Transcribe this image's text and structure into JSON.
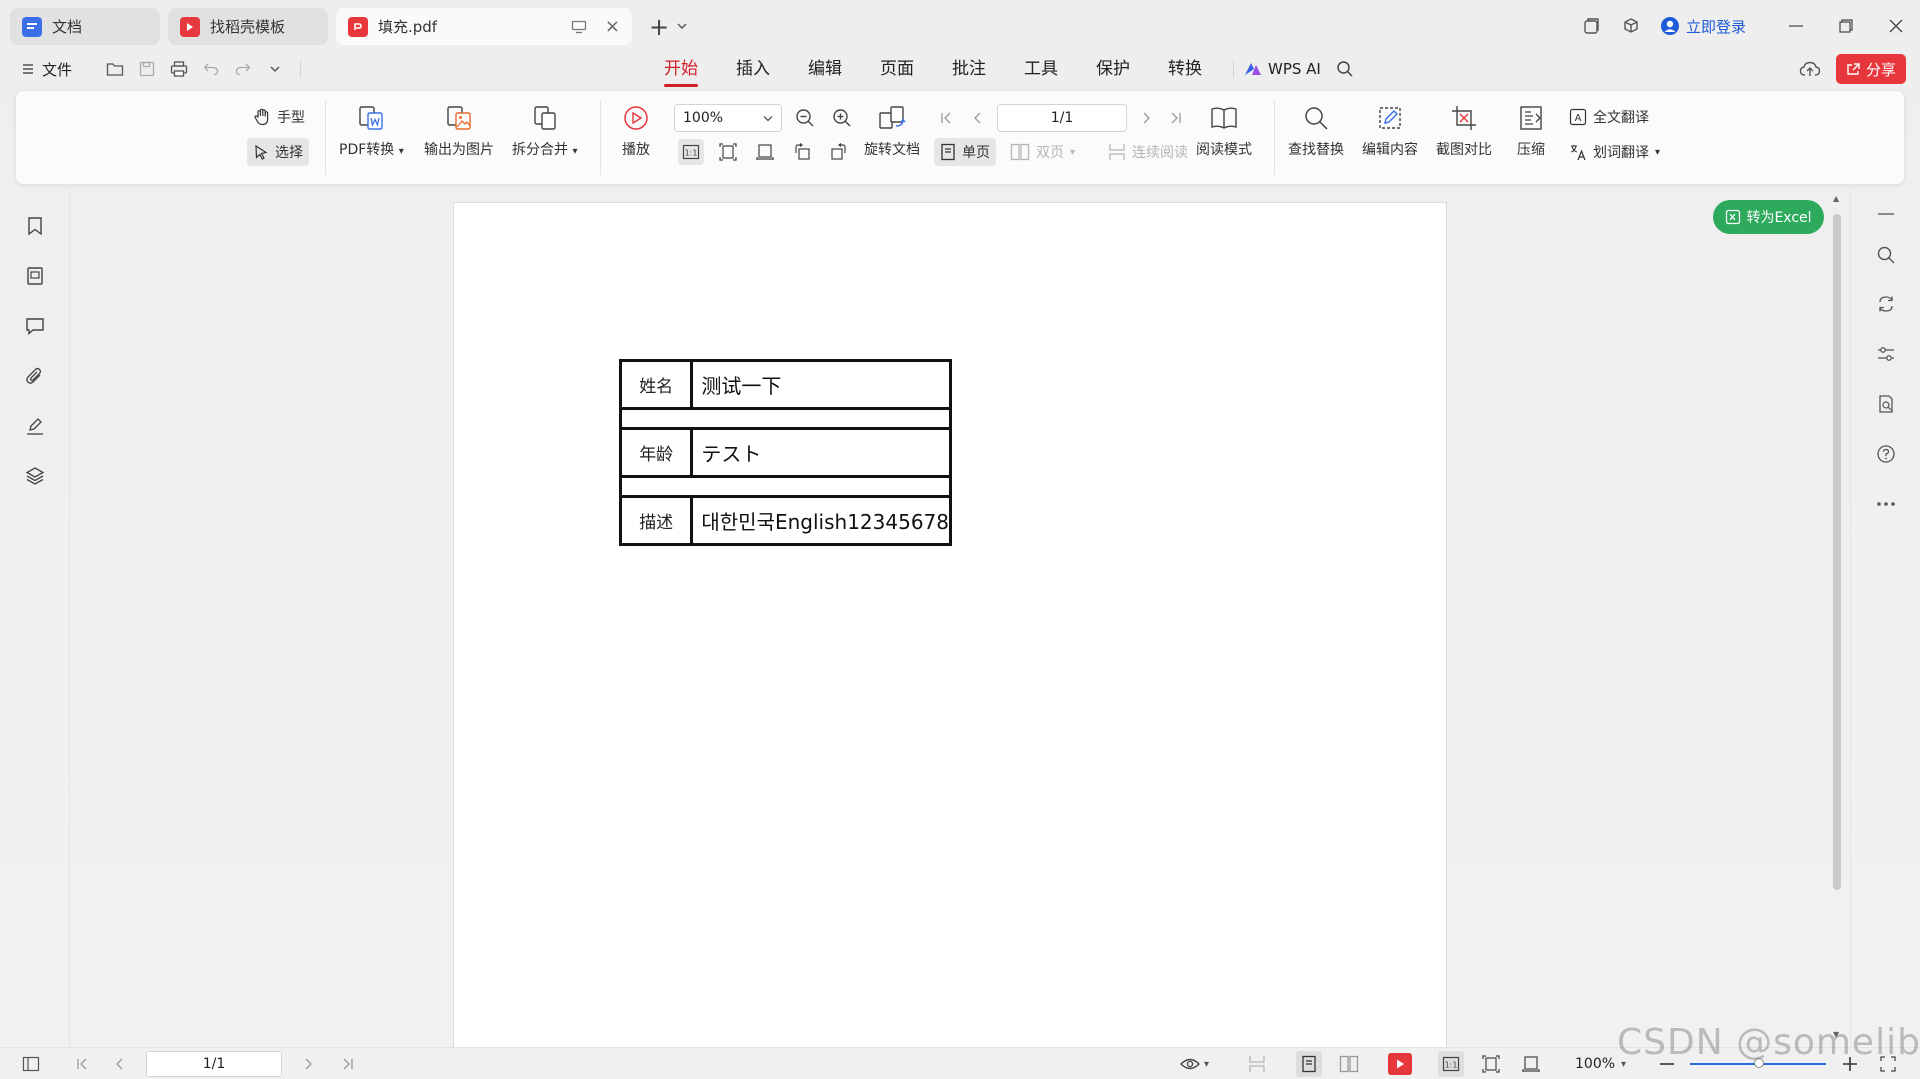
{
  "tabs": [
    {
      "label": "文档",
      "icon": "doc-icon",
      "state": "inactive"
    },
    {
      "label": "找稻壳模板",
      "icon": "docer-icon",
      "state": "inactive"
    },
    {
      "label": "填充.pdf",
      "icon": "pdf-icon",
      "state": "active"
    }
  ],
  "titlebar": {
    "new_tab": "+",
    "login_label": "立即登录"
  },
  "menu": {
    "file_label": "文件",
    "items": [
      "开始",
      "插入",
      "编辑",
      "页面",
      "批注",
      "工具",
      "保护",
      "转换"
    ],
    "active": "开始",
    "wps_ai_label": "WPS AI",
    "share_label": "分享"
  },
  "ribbon": {
    "hand_label": "手型",
    "select_label": "选择",
    "pdf_convert_label": "PDF转换",
    "export_image_label": "输出为图片",
    "split_merge_label": "拆分合并",
    "play_label": "播放",
    "zoom_value": "100%",
    "page_value": "1/1",
    "rotate_label": "旋转文档",
    "single_page_label": "单页",
    "double_page_label": "双页",
    "continuous_label": "连续阅读",
    "reading_mode_label": "阅读模式",
    "find_replace_label": "查找替换",
    "edit_content_label": "编辑内容",
    "screenshot_compare_label": "截图对比",
    "compress_label": "压缩",
    "full_translate_label": "全文翻译",
    "word_translate_label": "划词翻译"
  },
  "convert_excel_label": "转为Excel",
  "form": [
    {
      "label": "姓名",
      "value": "测试一下"
    },
    {
      "label": "年龄",
      "value": "テスト"
    },
    {
      "label": "描述",
      "value": "대한민국English12345678"
    }
  ],
  "statusbar": {
    "page_value": "1/1",
    "zoom_value": "100%"
  },
  "watermark": "CSDN @someliber",
  "colors": {
    "accent": "#d11f2a",
    "share_button": "#e8363d",
    "excel_button": "#2eaa5c",
    "login": "#1d5bd8"
  }
}
